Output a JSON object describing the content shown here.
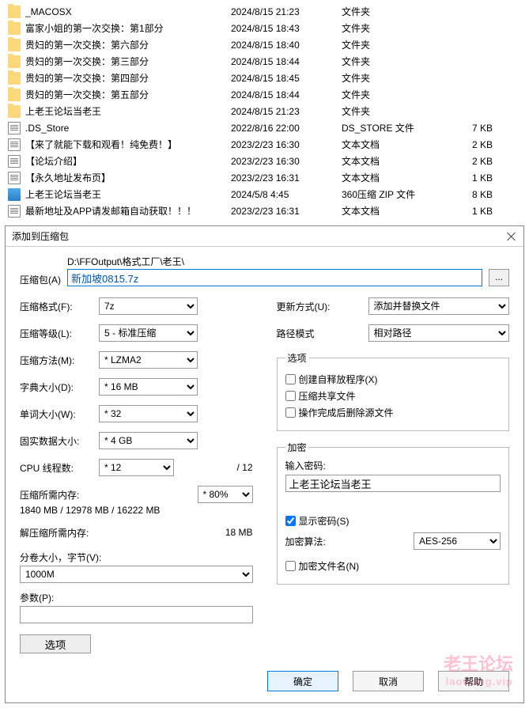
{
  "files": [
    {
      "name": "_MACOSX",
      "date": "2024/8/15 21:23",
      "type": "文件夹",
      "size": "",
      "icon": "folder"
    },
    {
      "name": "富家小姐的第一次交换：第1部分",
      "date": "2024/8/15 18:43",
      "type": "文件夹",
      "size": "",
      "icon": "folder"
    },
    {
      "name": "贵妇的第一次交换：第六部分",
      "date": "2024/8/15 18:40",
      "type": "文件夹",
      "size": "",
      "icon": "folder"
    },
    {
      "name": "贵妇的第一次交换：第三部分",
      "date": "2024/8/15 18:44",
      "type": "文件夹",
      "size": "",
      "icon": "folder"
    },
    {
      "name": "贵妇的第一次交换：第四部分",
      "date": "2024/8/15 18:45",
      "type": "文件夹",
      "size": "",
      "icon": "folder"
    },
    {
      "name": "贵妇的第一次交换：第五部分",
      "date": "2024/8/15 18:44",
      "type": "文件夹",
      "size": "",
      "icon": "folder"
    },
    {
      "name": "上老王论坛当老王",
      "date": "2024/8/15 21:23",
      "type": "文件夹",
      "size": "",
      "icon": "folder"
    },
    {
      "name": ".DS_Store",
      "date": "2022/8/16 22:00",
      "type": "DS_STORE 文件",
      "size": "7 KB",
      "icon": "doc"
    },
    {
      "name": "【来了就能下载和观看！纯免费！】",
      "date": "2023/2/23 16:30",
      "type": "文本文档",
      "size": "2 KB",
      "icon": "doc"
    },
    {
      "name": "【论坛介绍】",
      "date": "2023/2/23 16:30",
      "type": "文本文档",
      "size": "2 KB",
      "icon": "doc"
    },
    {
      "name": "【永久地址发布页】",
      "date": "2023/2/23 16:31",
      "type": "文本文档",
      "size": "1 KB",
      "icon": "doc"
    },
    {
      "name": "上老王论坛当老王",
      "date": "2024/5/8 4:45",
      "type": "360压缩 ZIP 文件",
      "size": "8 KB",
      "icon": "zip"
    },
    {
      "name": "最新地址及APP请发邮箱自动获取！！！",
      "date": "2023/2/23 16:31",
      "type": "文本文档",
      "size": "1 KB",
      "icon": "doc"
    }
  ],
  "dialog": {
    "title": "添加到压缩包",
    "archive_lbl": "压缩包(A)",
    "path": "D:\\FFOutput\\格式工厂\\老王\\",
    "archive_val": "新加坡0815.7z",
    "browse": "...",
    "format_lbl": "压缩格式(F):",
    "format_val": "7z",
    "level_lbl": "压缩等级(L):",
    "level_val": "5 - 标准压缩",
    "method_lbl": "压缩方法(M):",
    "method_val": "* LZMA2",
    "dict_lbl": "字典大小(D):",
    "dict_val": "* 16 MB",
    "word_lbl": "单词大小(W):",
    "word_val": "* 32",
    "solid_lbl": "固实数据大小:",
    "solid_val": "* 4 GB",
    "threads_lbl": "CPU 线程数:",
    "threads_val": "* 12",
    "threads_max": "/ 12",
    "mem_c_lbl": "压缩所需内存:",
    "mem_c_val": "1840 MB / 12978 MB / 16222 MB",
    "mem_c_sel": "* 80%",
    "mem_d_lbl": "解压缩所需内存:",
    "mem_d_val": "18 MB",
    "split_lbl": "分卷大小，字节(V):",
    "split_val": "1000M",
    "param_lbl": "参数(P):",
    "param_val": "",
    "options_btn": "选项",
    "update_lbl": "更新方式(U):",
    "update_val": "添加并替换文件",
    "pathmode_lbl": "路径模式",
    "pathmode_val": "相对路径",
    "opts_legend": "选项",
    "sfx": "创建自释放程序(X)",
    "shared": "压缩共享文件",
    "delafter": "操作完成后删除源文件",
    "enc_legend": "加密",
    "pwd_lbl": "输入密码:",
    "pwd_val": "上老王论坛当老王",
    "showpwd": "显示密码(S)",
    "algo_lbl": "加密算法:",
    "algo_val": "AES-256",
    "encnames": "加密文件名(N)",
    "ok": "确定",
    "cancel": "取消",
    "help": "帮助"
  },
  "watermark": {
    "l1": "老王论坛",
    "l2": "laowang.vip"
  }
}
